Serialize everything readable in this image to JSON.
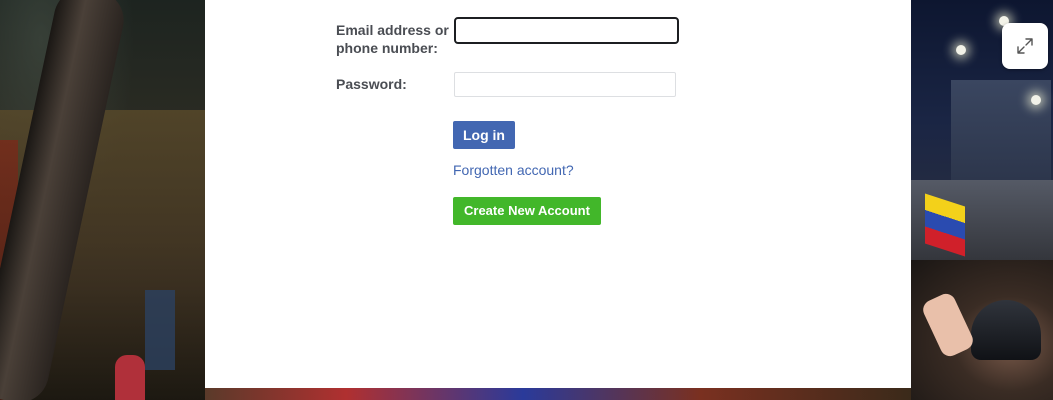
{
  "login": {
    "email_label": "Email address or phone number:",
    "email_value": "",
    "password_label": "Password:",
    "password_value": "",
    "login_button": "Log in",
    "forgot_link": "Forgotten account?",
    "create_button": "Create New Account"
  },
  "expand": {
    "icon": "expand-icon"
  },
  "colors": {
    "login_button": "#4267b2",
    "create_button": "#42b72a",
    "link": "#4267b2",
    "label": "#4a4d53"
  }
}
